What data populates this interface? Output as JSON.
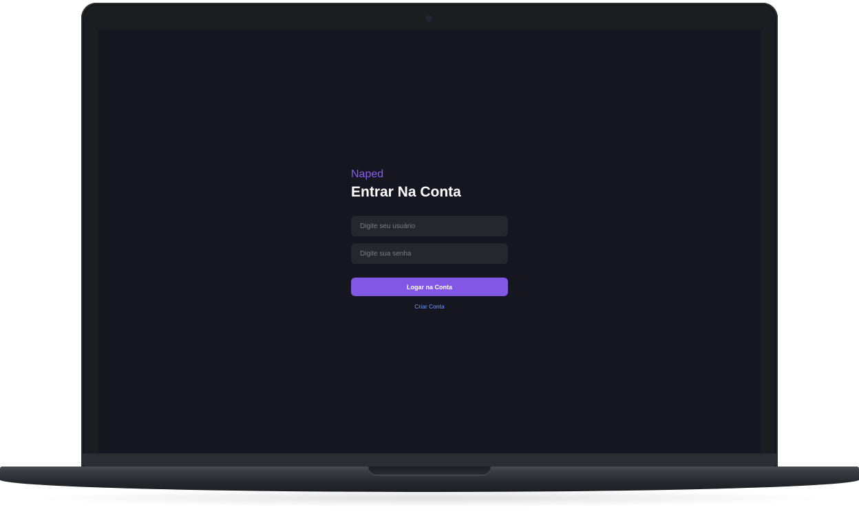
{
  "login": {
    "brand": "Naped",
    "title": "Entrar Na Conta",
    "username_placeholder": "Digite seu usuário",
    "password_placeholder": "Digite sua senha",
    "submit_label": "Logar na Conta",
    "create_account_label": "Criar Conta"
  },
  "colors": {
    "background": "#161620",
    "accent": "#8257e5",
    "brand_text": "#8a5cf0",
    "field_background": "#26262f",
    "link": "#6f9cff"
  }
}
